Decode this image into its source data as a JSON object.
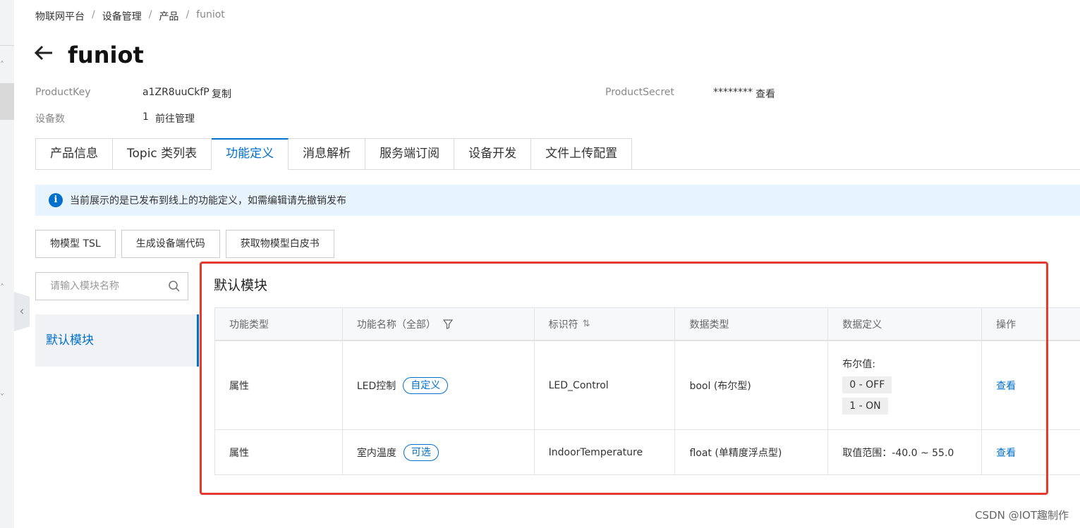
{
  "breadcrumb": [
    "物联网平台",
    "设备管理",
    "产品",
    "funiot"
  ],
  "title": "funiot",
  "info": {
    "product_key_label": "ProductKey",
    "product_key_value": "a1ZR8uuCkfP",
    "copy_link": "复制",
    "product_secret_label": "ProductSecret",
    "product_secret_value": "********",
    "view_link": "查看",
    "device_count_label": "设备数",
    "device_count_value": "1",
    "manage_link": "前往管理"
  },
  "tabs": [
    "产品信息",
    "Topic 类列表",
    "功能定义",
    "消息解析",
    "服务端订阅",
    "设备开发",
    "文件上传配置"
  ],
  "active_tab": "功能定义",
  "alert": {
    "icon": "i",
    "text": "当前展示的是已发布到线上的功能定义，如需编辑请先撤销发布"
  },
  "buttons": [
    "物模型 TSL",
    "生成设备端代码",
    "获取物模型白皮书"
  ],
  "search": {
    "placeholder": "请输入模块名称"
  },
  "modules": [
    "默认模块"
  ],
  "panel_title": "默认模块",
  "table": {
    "headers": [
      "功能类型",
      "功能名称（全部）",
      "标识符",
      "数据类型",
      "数据定义",
      "操作"
    ],
    "rows": [
      {
        "type": "属性",
        "name": "LED控制",
        "tag": "自定义",
        "identifier": "LED_Control",
        "data_type": "bool (布尔型)",
        "definition_label": "布尔值:",
        "definition_values": [
          "0 - OFF",
          "1 - ON"
        ],
        "action": "查看"
      },
      {
        "type": "属性",
        "name": "室内温度",
        "tag": "可选",
        "identifier": "IndoorTemperature",
        "data_type": "float (单精度浮点型)",
        "definition_text": "取值范围：-40.0 ~ 55.0",
        "action": "查看"
      }
    ]
  },
  "watermark": "CSDN @IOT趣制作",
  "colors": {
    "accent": "#0070cc",
    "highlight_box": "#e53a2f",
    "alert_bg": "#e8f4fd"
  }
}
